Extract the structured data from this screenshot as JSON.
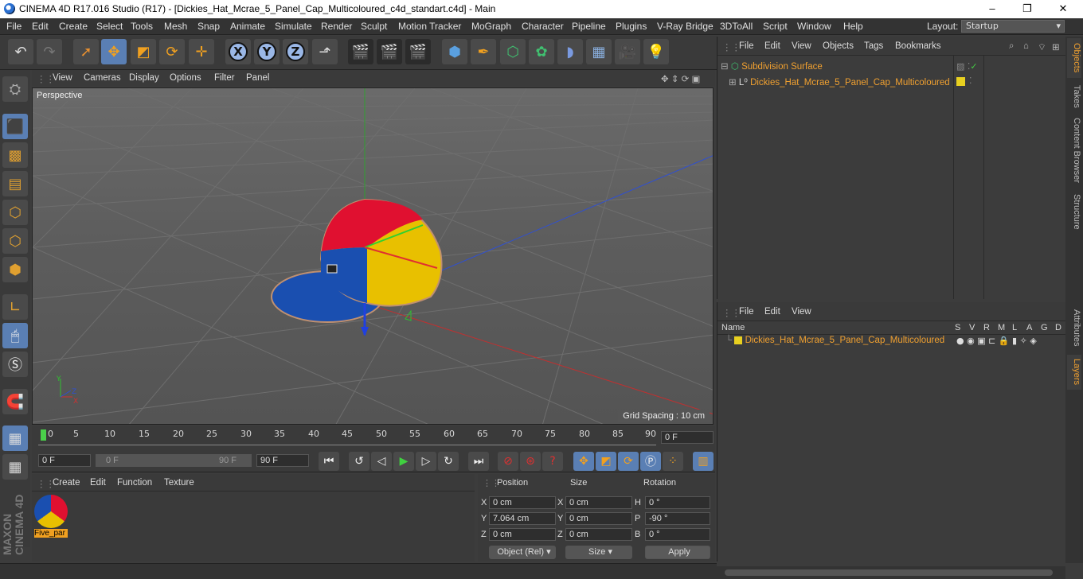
{
  "window": {
    "title": "CINEMA 4D R17.016 Studio (R17) - [Dickies_Hat_Mcrae_5_Panel_Cap_Multicoloured_c4d_standart.c4d] - Main",
    "minimize": "–",
    "maximize": "❐",
    "close": "✕"
  },
  "menubar": {
    "items": [
      "File",
      "Edit",
      "Create",
      "Select",
      "Tools",
      "Mesh",
      "Snap",
      "Animate",
      "Simulate",
      "Render",
      "Sculpt",
      "Motion Tracker",
      "MoGraph",
      "Character",
      "Pipeline",
      "Plugins",
      "V-Ray Bridge",
      "3DToAll",
      "Script",
      "Window",
      "Help"
    ],
    "layout_label": "Layout:",
    "layout_value": "Startup"
  },
  "toolbar": {
    "undo_icon": "undo-icon",
    "x_label": "X",
    "y_label": "Y",
    "z_label": "Z"
  },
  "viewport": {
    "menu": [
      "View",
      "Cameras",
      "Display",
      "Options",
      "Filter",
      "Panel"
    ],
    "camera_label": "Perspective",
    "grid_spacing": "Grid Spacing : 10 cm",
    "colors": {
      "x_axis": "#d03030",
      "y_axis": "#30b030",
      "z_axis": "#3050d0"
    }
  },
  "timeline": {
    "ticks": [
      "0",
      "5",
      "10",
      "15",
      "20",
      "25",
      "30",
      "35",
      "40",
      "45",
      "50",
      "55",
      "60",
      "65",
      "70",
      "75",
      "80",
      "85",
      "90"
    ],
    "current_frame": "0 F"
  },
  "playback": {
    "start_field": "0 F",
    "range_start": "0 F",
    "range_end": "90 F",
    "end_field": "90 F"
  },
  "material_manager": {
    "menu": [
      "Create",
      "Edit",
      "Function",
      "Texture"
    ],
    "material_name": "Five_par"
  },
  "coordinates": {
    "headers": {
      "position": "Position",
      "size": "Size",
      "rotation": "Rotation"
    },
    "rows": [
      {
        "axis": "X",
        "pos": "0 cm",
        "size_axis": "X",
        "size": "0 cm",
        "rot_axis": "H",
        "rot": "0 °"
      },
      {
        "axis": "Y",
        "pos": "7.064 cm",
        "size_axis": "Y",
        "size": "0 cm",
        "rot_axis": "P",
        "rot": "-90 °"
      },
      {
        "axis": "Z",
        "pos": "0 cm",
        "size_axis": "Z",
        "size": "0 cm",
        "rot_axis": "B",
        "rot": "0 °"
      }
    ],
    "mode_select": "Object (Rel)",
    "size_select": "Size",
    "apply": "Apply"
  },
  "object_manager": {
    "menu": [
      "File",
      "Edit",
      "View",
      "Objects",
      "Tags",
      "Bookmarks"
    ],
    "objects": [
      {
        "name": "Subdivision Surface"
      },
      {
        "name": "Dickies_Hat_Mcrae_5_Panel_Cap_Multicoloured"
      }
    ]
  },
  "layer_manager": {
    "menu": [
      "File",
      "Edit",
      "View"
    ],
    "columns": [
      "Name",
      "S",
      "V",
      "R",
      "M",
      "L",
      "A",
      "G",
      "D"
    ],
    "layers": [
      {
        "name": "Dickies_Hat_Mcrae_5_Panel_Cap_Multicoloured",
        "color": "#e8d020"
      }
    ]
  },
  "right_tabs": [
    "Objects",
    "Takes",
    "Content Browser",
    "Structure",
    "Attributes",
    "Layers"
  ],
  "branding": "MAXON CINEMA 4D"
}
